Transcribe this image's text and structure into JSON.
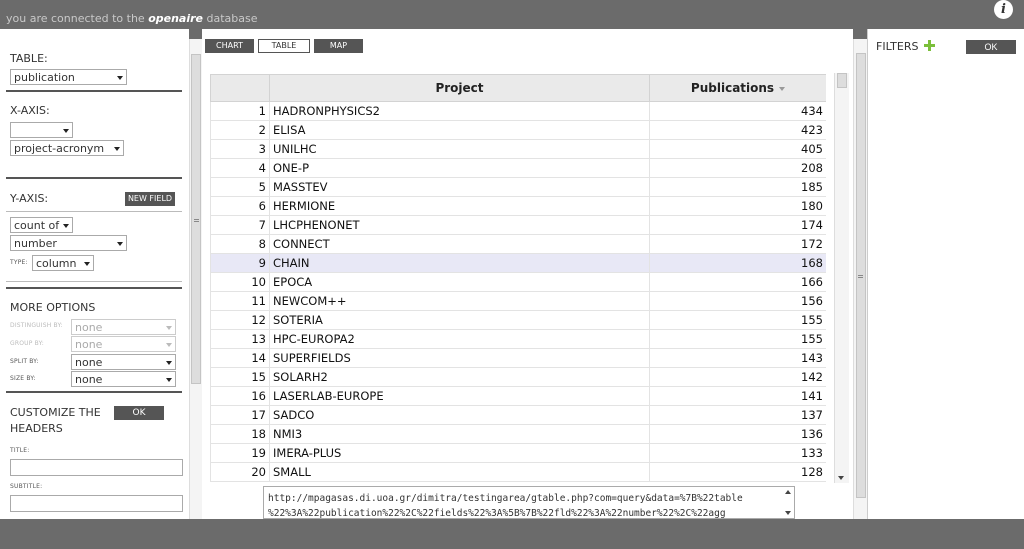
{
  "topbar": {
    "conn_prefix": "you are connected to the",
    "db_name": "openaire",
    "conn_suffix": "database",
    "info_glyph": "i"
  },
  "left": {
    "table_title": "TABLE:",
    "table_value": "publication",
    "xaxis_title": "X-AXIS:",
    "xaxis_sel1": "",
    "xaxis_sel2": "project-acronym",
    "yaxis_title": "Y-AXIS:",
    "new_field": "NEW FIELD",
    "count_of": "count of",
    "number": "number",
    "type_label": "TYPE:",
    "type_value": "column",
    "more_title": "MORE OPTIONS",
    "distinguish_label": "DISTINGUISH BY:",
    "distinguish_value": "none",
    "group_label": "GROUP BY:",
    "group_value": "none",
    "split_label": "SPLIT BY:",
    "split_value": "none",
    "size_label": "SIZE BY:",
    "size_value": "none",
    "customize_title_1": "CUSTOMIZE THE",
    "customize_title_2": "HEADERS",
    "ok": "OK",
    "title_label": "TITLE:",
    "subtitle_label": "SUBTITLE:"
  },
  "tabs": {
    "chart": "CHART",
    "table": "TABLE",
    "map": "MAP"
  },
  "table": {
    "headers": {
      "project": "Project",
      "publications": "Publications"
    },
    "rows": [
      {
        "n": "1",
        "project": "HADRONPHYSICS2",
        "value": "434"
      },
      {
        "n": "2",
        "project": "ELISA",
        "value": "423"
      },
      {
        "n": "3",
        "project": "UNILHC",
        "value": "405"
      },
      {
        "n": "4",
        "project": "ONE-P",
        "value": "208"
      },
      {
        "n": "5",
        "project": "MASSTEV",
        "value": "185"
      },
      {
        "n": "6",
        "project": "HERMIONE",
        "value": "180"
      },
      {
        "n": "7",
        "project": "LHCPHENONET",
        "value": "174"
      },
      {
        "n": "8",
        "project": "CONNECT",
        "value": "172"
      },
      {
        "n": "9",
        "project": "CHAIN",
        "value": "168"
      },
      {
        "n": "10",
        "project": "EPOCA",
        "value": "166"
      },
      {
        "n": "11",
        "project": "NEWCOM++",
        "value": "156"
      },
      {
        "n": "12",
        "project": "SOTERIA",
        "value": "155"
      },
      {
        "n": "13",
        "project": "HPC-EUROPA2",
        "value": "155"
      },
      {
        "n": "14",
        "project": "SUPERFIELDS",
        "value": "143"
      },
      {
        "n": "15",
        "project": "SOLARH2",
        "value": "142"
      },
      {
        "n": "16",
        "project": "LASERLAB-EUROPE",
        "value": "141"
      },
      {
        "n": "17",
        "project": "SADCO",
        "value": "137"
      },
      {
        "n": "18",
        "project": "NMI3",
        "value": "136"
      },
      {
        "n": "19",
        "project": "IMERA-PLUS",
        "value": "133"
      },
      {
        "n": "20",
        "project": "SMALL",
        "value": "128"
      }
    ]
  },
  "url": {
    "line1": "http://mpagasas.di.uoa.gr/dimitra/testingarea/gtable.php?com=query&data=%7B%22table",
    "line2": "%22%3A%22publication%22%2C%22fields%22%3A%5B%7B%22fld%22%3A%22number%22%2C%22agg"
  },
  "right": {
    "filters_label": "FILTERS",
    "ok": "OK"
  }
}
